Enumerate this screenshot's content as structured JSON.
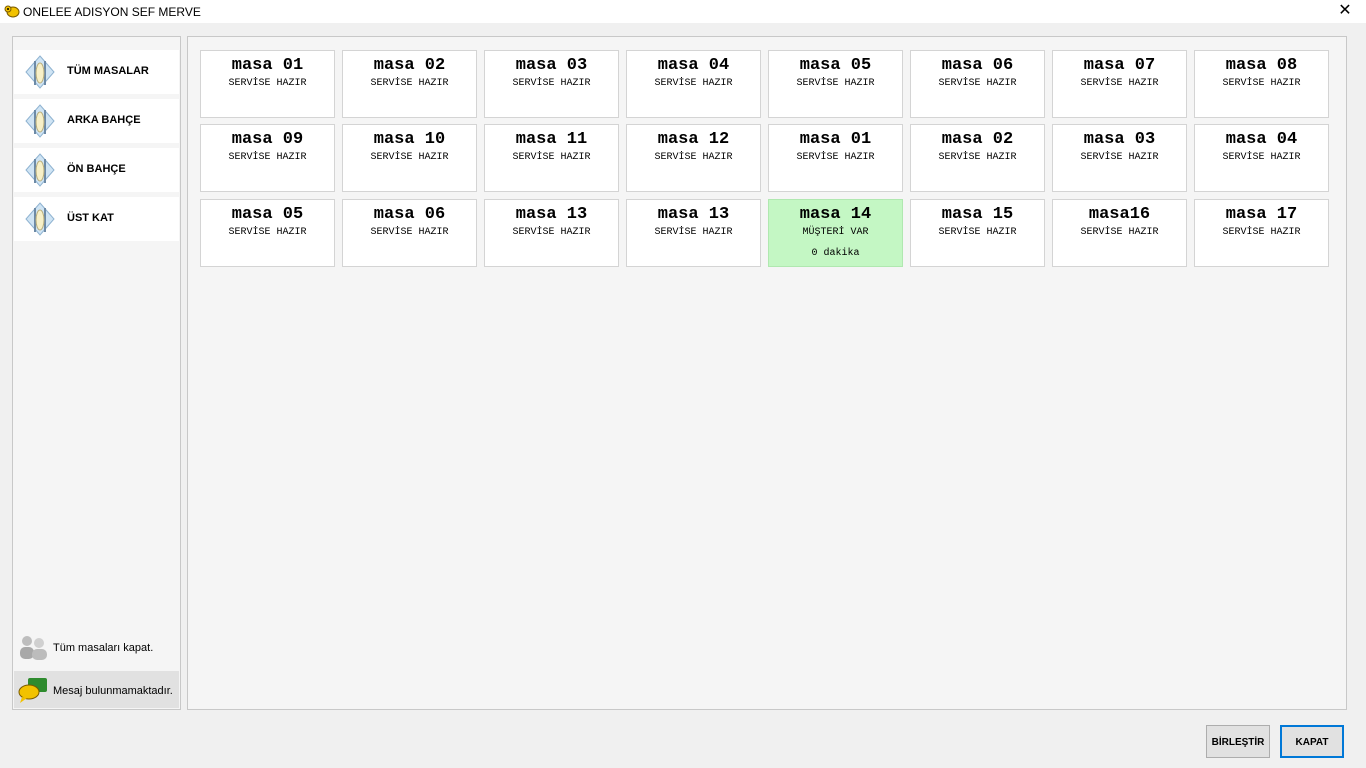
{
  "window": {
    "title": "ONELEE ADISYON SEF MERVE",
    "close_glyph": "✕"
  },
  "sidebar": {
    "items": [
      {
        "label": "TÜM MASALAR",
        "icon": "cutlery-icon"
      },
      {
        "label": "ARKA BAHÇE",
        "icon": "cutlery-icon"
      },
      {
        "label": "ÖN BAHÇE",
        "icon": "cutlery-icon"
      },
      {
        "label": "ÜST KAT",
        "icon": "cutlery-icon"
      }
    ],
    "close_all_label": "Tüm masaları kapat.",
    "message_label": "Mesaj bulunmamaktadır."
  },
  "tables": [
    {
      "name": "masa 01",
      "status": "SERVİSE HAZIR"
    },
    {
      "name": "masa 02",
      "status": "SERVİSE HAZIR"
    },
    {
      "name": "masa 03",
      "status": "SERVİSE HAZIR"
    },
    {
      "name": "masa 04",
      "status": "SERVİSE HAZIR"
    },
    {
      "name": "masa 05",
      "status": "SERVİSE HAZIR"
    },
    {
      "name": "masa 06",
      "status": "SERVİSE HAZIR"
    },
    {
      "name": "masa 07",
      "status": "SERVİSE HAZIR"
    },
    {
      "name": "masa 08",
      "status": "SERVİSE HAZIR"
    },
    {
      "name": "masa 09",
      "status": "SERVİSE HAZIR"
    },
    {
      "name": "masa 10",
      "status": "SERVİSE HAZIR"
    },
    {
      "name": "masa 11",
      "status": "SERVİSE HAZIR"
    },
    {
      "name": "masa 12",
      "status": "SERVİSE HAZIR"
    },
    {
      "name": "masa 01",
      "status": "SERVİSE HAZIR"
    },
    {
      "name": "masa 02",
      "status": "SERVİSE HAZIR"
    },
    {
      "name": "masa 03",
      "status": "SERVİSE HAZIR"
    },
    {
      "name": "masa 04",
      "status": "SERVİSE HAZIR"
    },
    {
      "name": "masa 05",
      "status": "SERVİSE HAZIR"
    },
    {
      "name": "masa 06",
      "status": "SERVİSE HAZIR"
    },
    {
      "name": "masa 13",
      "status": "SERVİSE HAZIR"
    },
    {
      "name": "masa 13",
      "status": "SERVİSE HAZIR"
    },
    {
      "name": "masa 14",
      "status": "MÜŞTERİ VAR",
      "time": "0 dakika",
      "occupied": true
    },
    {
      "name": "masa 15",
      "status": "SERVİSE HAZIR"
    },
    {
      "name": "masa16",
      "status": "SERVİSE HAZIR"
    },
    {
      "name": "masa 17",
      "status": "SERVİSE HAZIR"
    }
  ],
  "colors": {
    "occupied": "#c4f7c4",
    "free": "#ffffff"
  },
  "buttons": {
    "merge": "BİRLEŞTİR",
    "close": "KAPAT"
  }
}
